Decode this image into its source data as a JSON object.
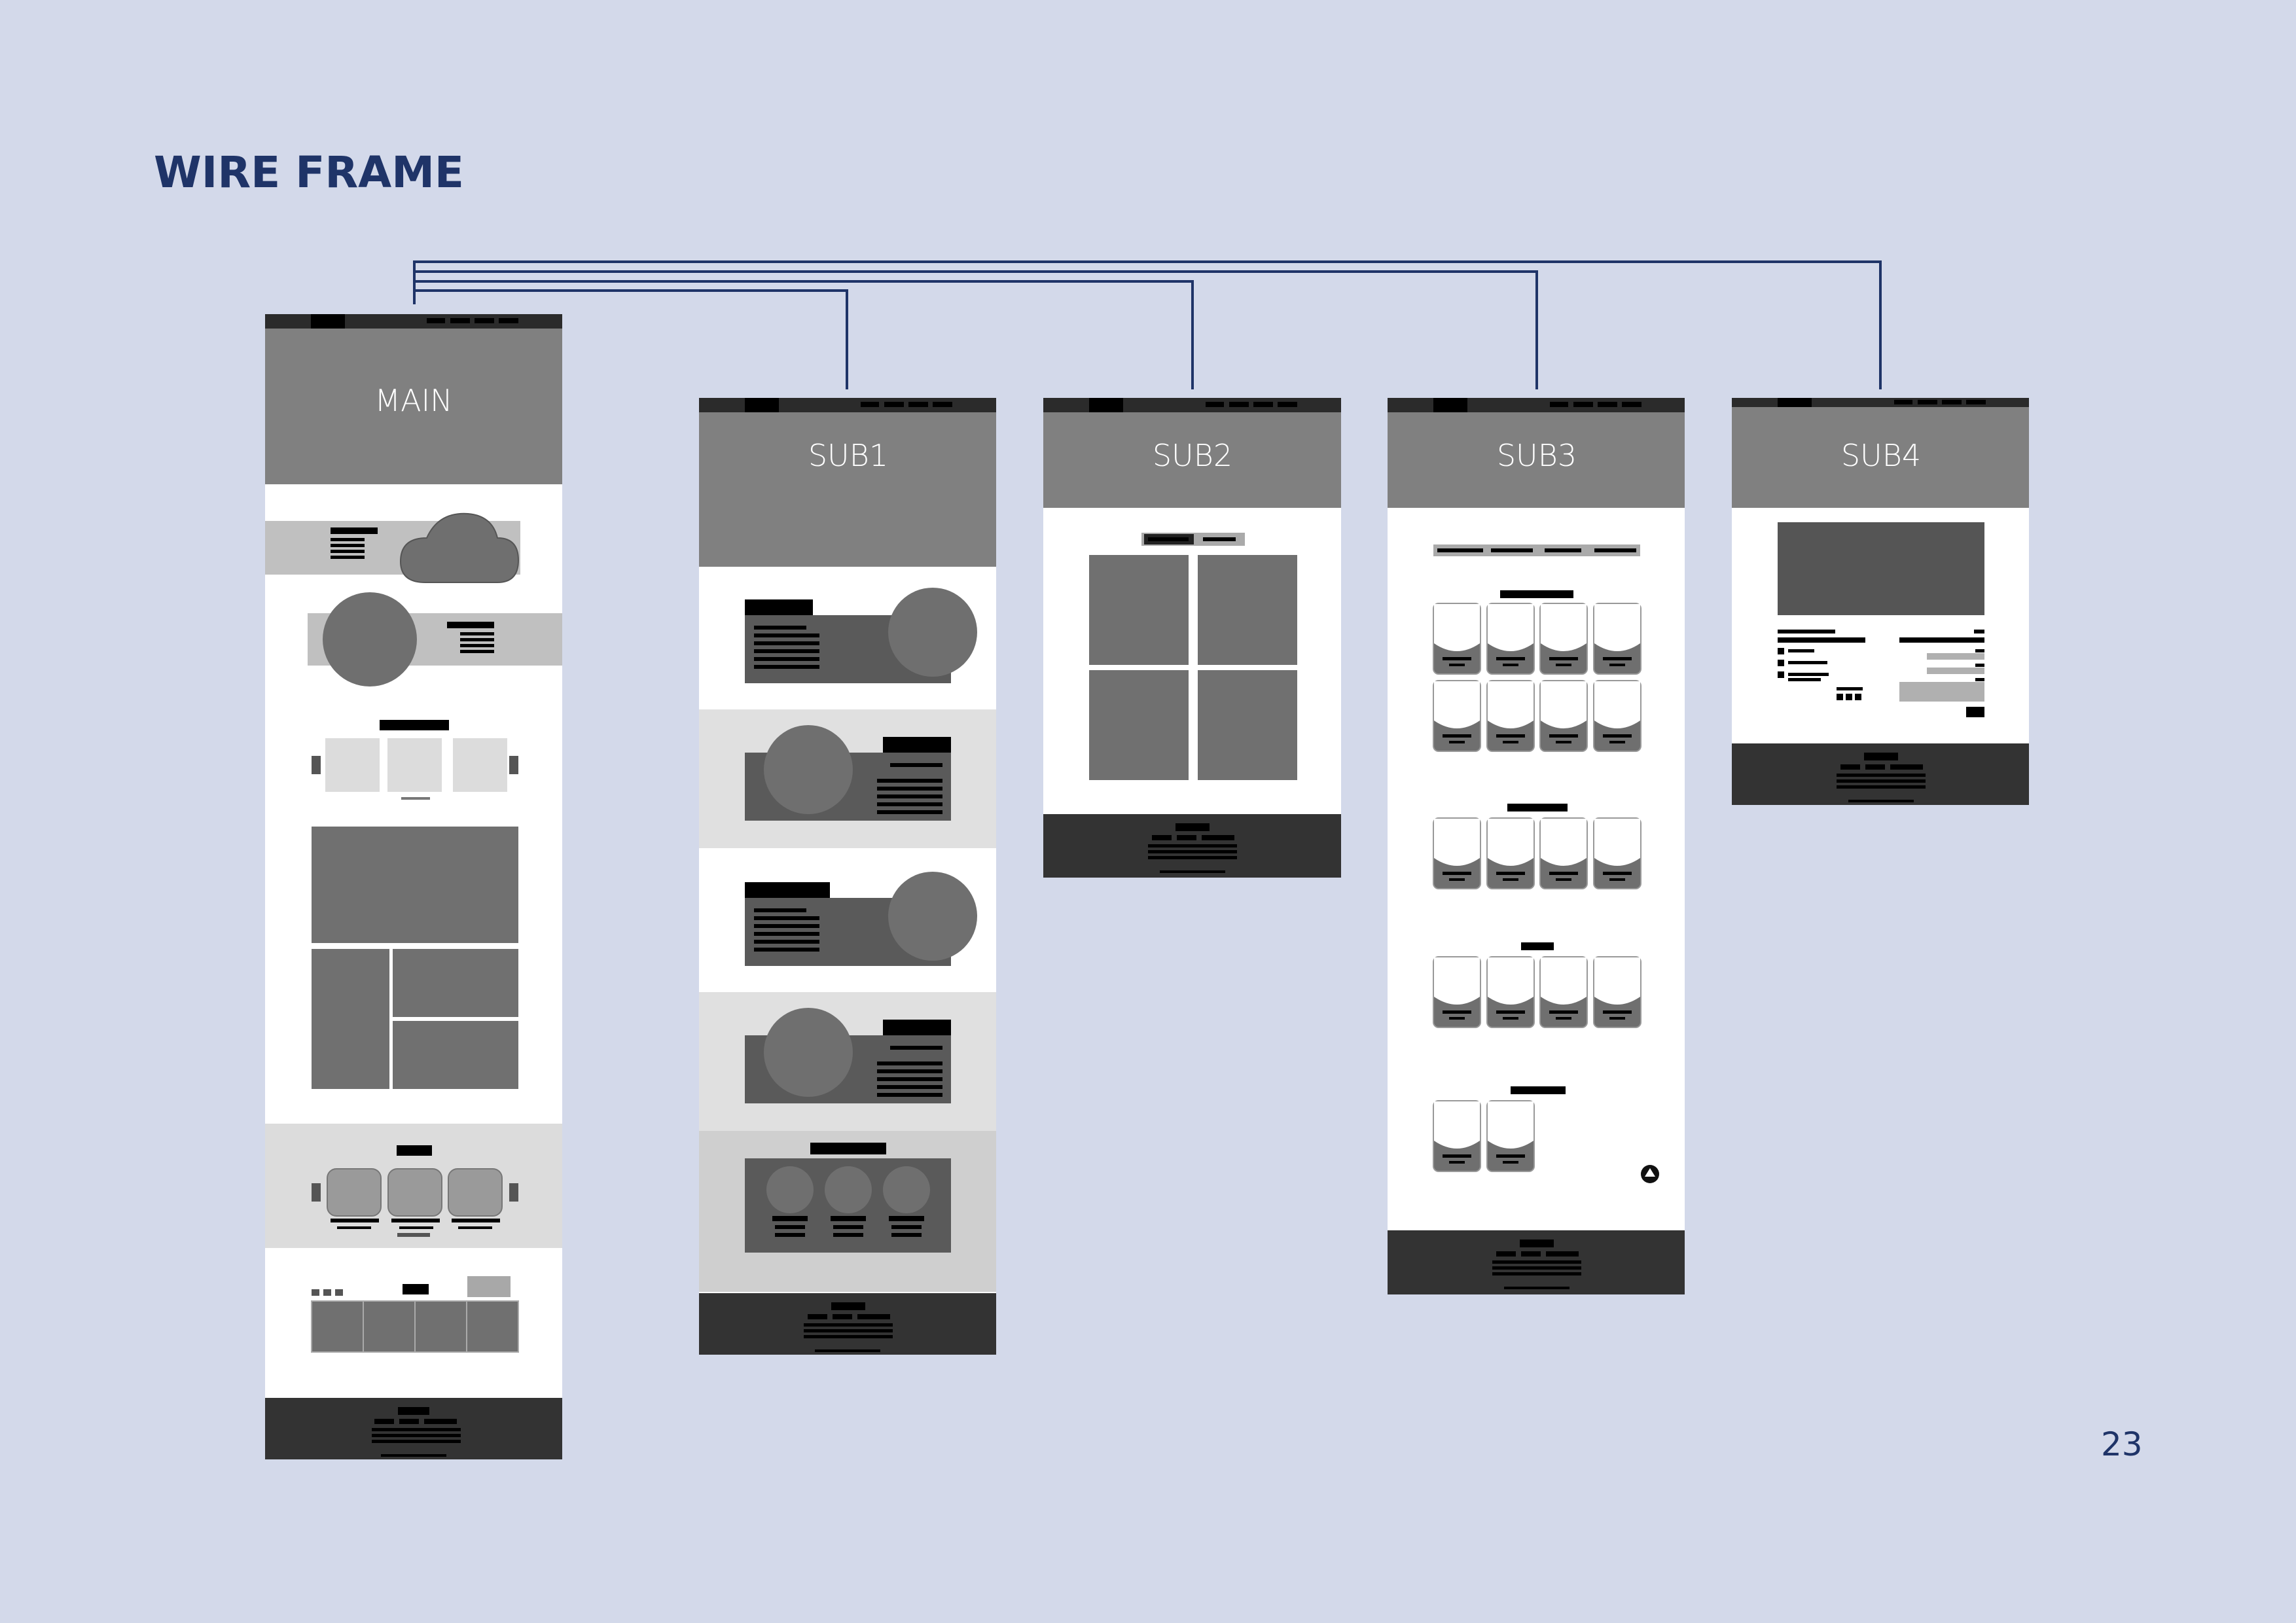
{
  "page": {
    "title": "WIRE FRAME",
    "page_number": "23"
  },
  "frames": {
    "main": "MAIN",
    "sub1": "SUB1",
    "sub2": "SUB2",
    "sub3": "SUB3",
    "sub4": "SUB4"
  },
  "colors": {
    "background": "#d3d9ea",
    "accent": "#1f3468",
    "header": "#808080",
    "dark": "#333333",
    "mid": "#707070",
    "light": "#dcdcdc"
  }
}
